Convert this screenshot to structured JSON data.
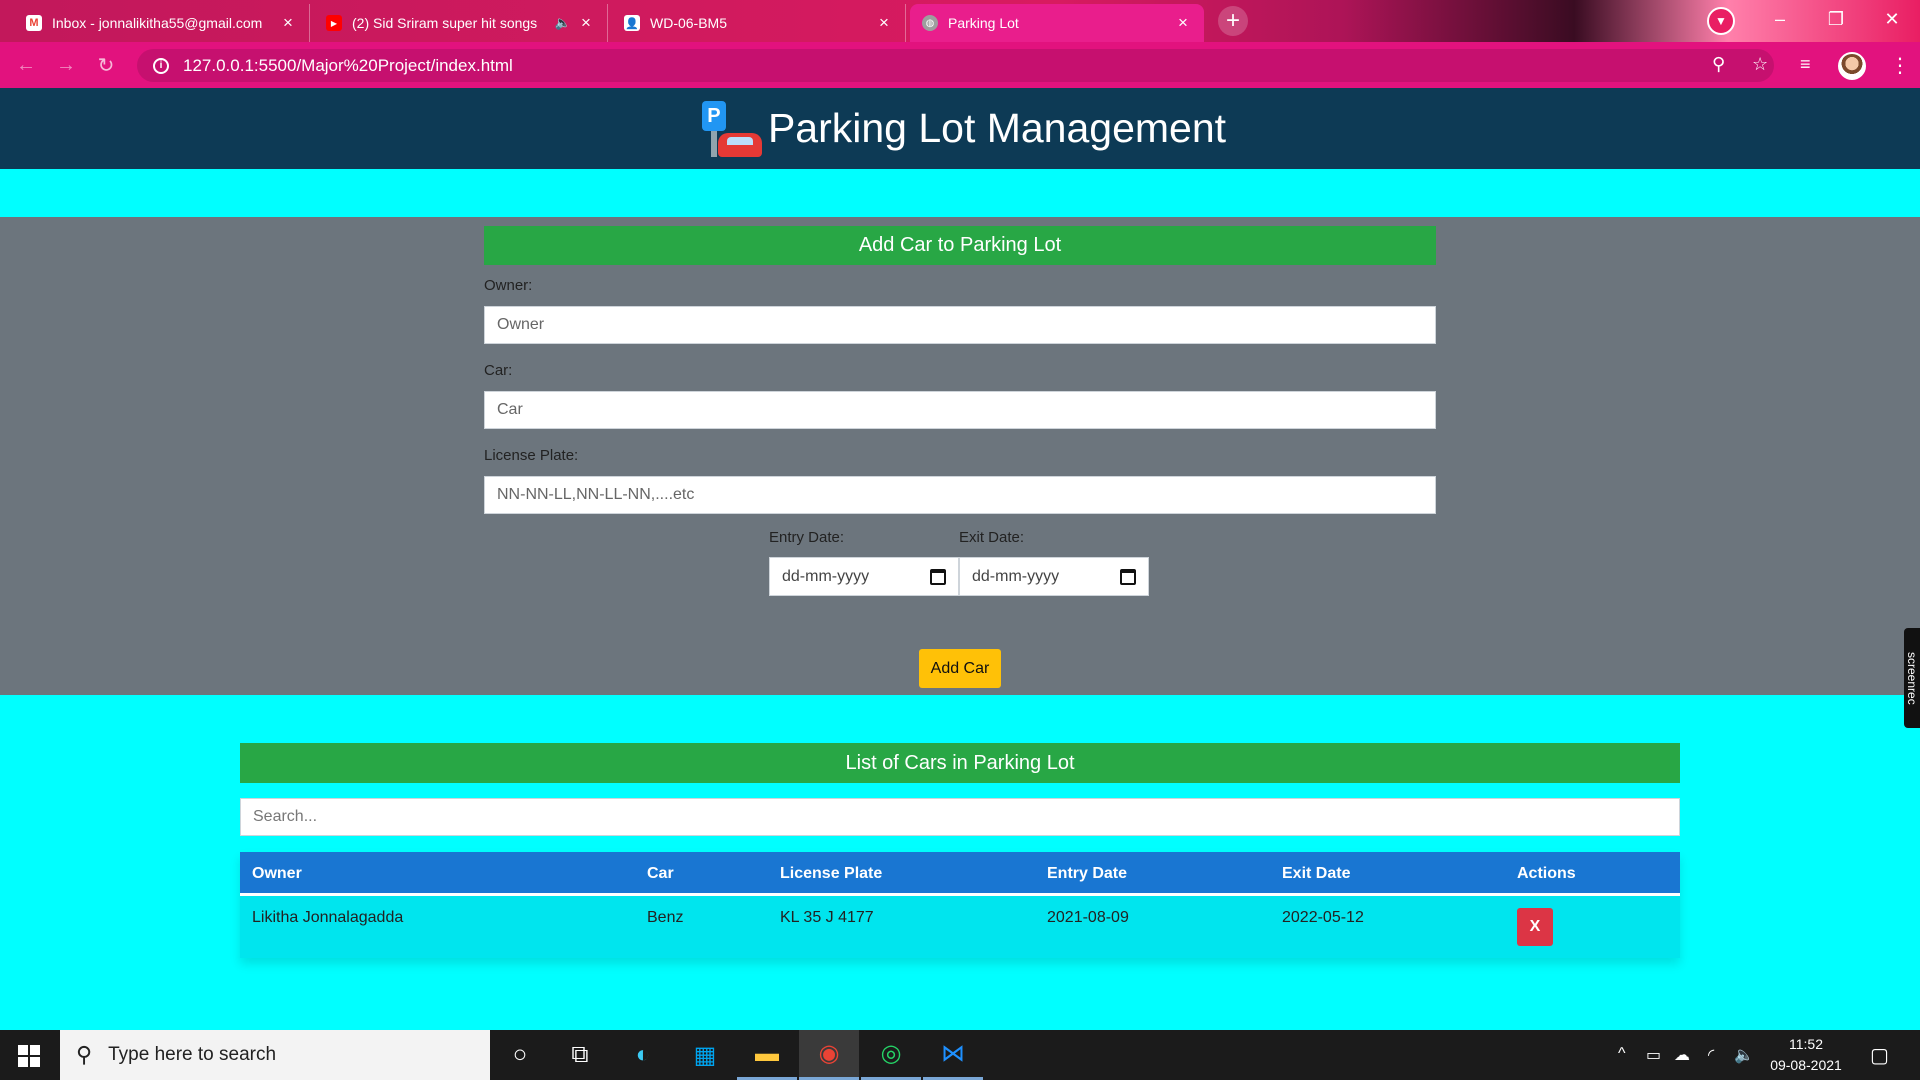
{
  "browser": {
    "tabs": [
      {
        "title": "Inbox - jonnalikitha55@gmail.com",
        "icon": "gmail-icon",
        "close": "×"
      },
      {
        "title": "(2) Sid Sriram super hit songs",
        "icon": "youtube-icon",
        "close": "×"
      },
      {
        "title": "WD-06-BM5",
        "icon": "contact-icon",
        "close": "×"
      },
      {
        "title": "Parking Lot",
        "icon": "globe-icon",
        "close": "×"
      }
    ],
    "new_tab": "+",
    "url": "127.0.0.1:5500/Major%20Project/index.html"
  },
  "header": {
    "title": "Parking Lot Management",
    "logo_letter": "P"
  },
  "form": {
    "heading": "Add Car to Parking Lot",
    "owner_label": "Owner:",
    "owner_placeholder": "Owner",
    "car_label": "Car:",
    "car_placeholder": "Car",
    "plate_label": "License Plate:",
    "plate_placeholder": "NN-NN-LL,NN-LL-NN,....etc",
    "entry_label": "Entry Date:",
    "entry_placeholder": "dd-mm-yyyy",
    "exit_label": "Exit Date:",
    "exit_placeholder": "dd-mm-yyyy",
    "submit_label": "Add Car"
  },
  "list": {
    "heading": "List of Cars in Parking Lot",
    "search_placeholder": "Search...",
    "columns": [
      "Owner",
      "Car",
      "License Plate",
      "Entry Date",
      "Exit Date",
      "Actions"
    ],
    "rows": [
      {
        "owner": "Likitha Jonnalagadda",
        "car": "Benz",
        "plate": "KL 35 J 4177",
        "entry": "2021-08-09",
        "exit": "2022-05-12",
        "action": "X"
      }
    ]
  },
  "overlay": {
    "screenrec": "screenrec"
  },
  "taskbar": {
    "search_placeholder": "Type here to search",
    "time": "11:52",
    "date": "09-08-2021"
  },
  "colors": {
    "page_bg": "#00ffff",
    "header_bg": "#0d3a55",
    "form_bg": "#6c757d",
    "heading_green": "#28a745",
    "table_head": "#1976d2",
    "add_button": "#ffc107",
    "delete_button": "#dc3545"
  }
}
